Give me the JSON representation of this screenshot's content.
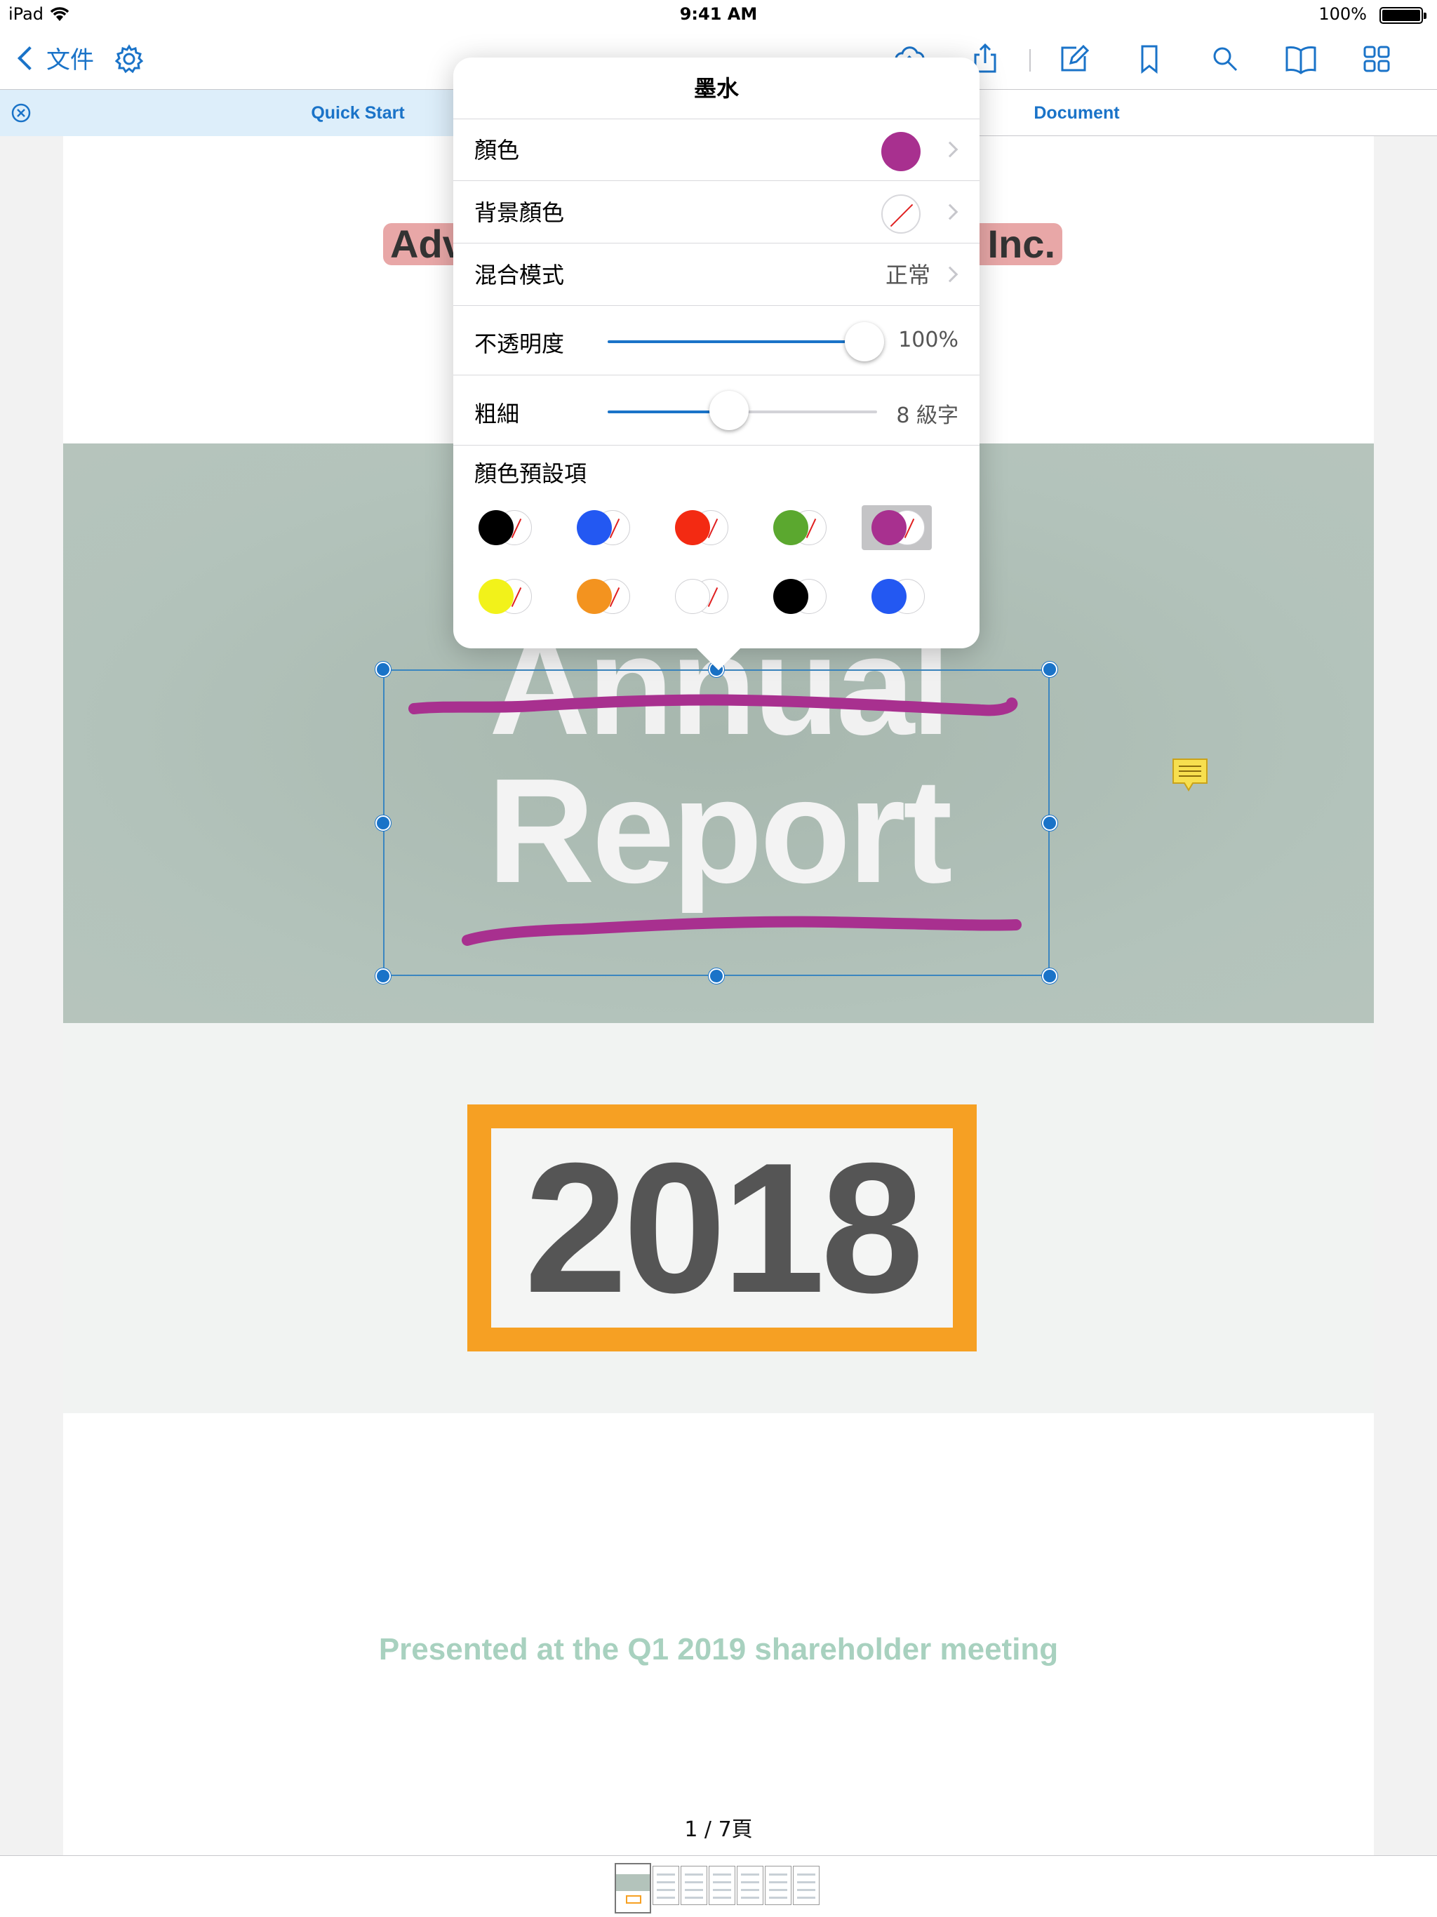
{
  "status_bar": {
    "device": "iPad",
    "time": "9:41 AM",
    "battery": "100%"
  },
  "nav": {
    "back_label": "文件",
    "icons": [
      "gear-icon",
      "cloud-upload-icon",
      "share-icon",
      "edit-annotations-icon",
      "bookmark-icon",
      "search-icon",
      "reader-view-icon",
      "thumbnail-grid-icon"
    ]
  },
  "tabs": [
    {
      "label": "Quick Start",
      "active": true
    },
    {
      "label": "Document",
      "active": false
    }
  ],
  "document": {
    "company_left": "Adv",
    "company_right": "Inc.",
    "title_line1": "Annual",
    "title_line2": "Report",
    "year": "2018",
    "presented": "Presented at the Q1 2019 shareholder meeting",
    "page_indicator": "1 / 7頁",
    "page_count": 7,
    "current_page": 1
  },
  "ink_popover": {
    "title": "墨水",
    "color_label": "顏色",
    "color_value": "#a8308f",
    "fill_color_label": "背景顏色",
    "blend_label": "混合模式",
    "blend_value": "正常",
    "opacity_label": "不透明度",
    "opacity_value": "100%",
    "opacity_fraction": 1.0,
    "thickness_label": "粗細",
    "thickness_value": "8 級字",
    "thickness_fraction": 0.45,
    "presets_label": "顏色預設項",
    "presets": [
      {
        "color": "#000000",
        "bg": "none",
        "selected": false
      },
      {
        "color": "#2358f2",
        "bg": "none",
        "selected": false
      },
      {
        "color": "#f32a12",
        "bg": "none",
        "selected": false
      },
      {
        "color": "#5ba82f",
        "bg": "none",
        "selected": false
      },
      {
        "color": "#a8308f",
        "bg": "none",
        "selected": true
      },
      {
        "color": "#f2f21a",
        "bg": "none",
        "selected": false
      },
      {
        "color": "#f3931f",
        "bg": "none",
        "selected": false
      },
      {
        "color": "#ffffff",
        "bg": "none",
        "selected": false
      },
      {
        "color": "#000000",
        "bg": "white",
        "selected": false
      },
      {
        "color": "#2358f2",
        "bg": "white",
        "selected": false
      }
    ]
  },
  "colors": {
    "accent": "#1a73c8",
    "ink": "#a8308f",
    "year_border": "#f6a023",
    "hero": "#b3c3bb",
    "note": "#f7df4f"
  }
}
